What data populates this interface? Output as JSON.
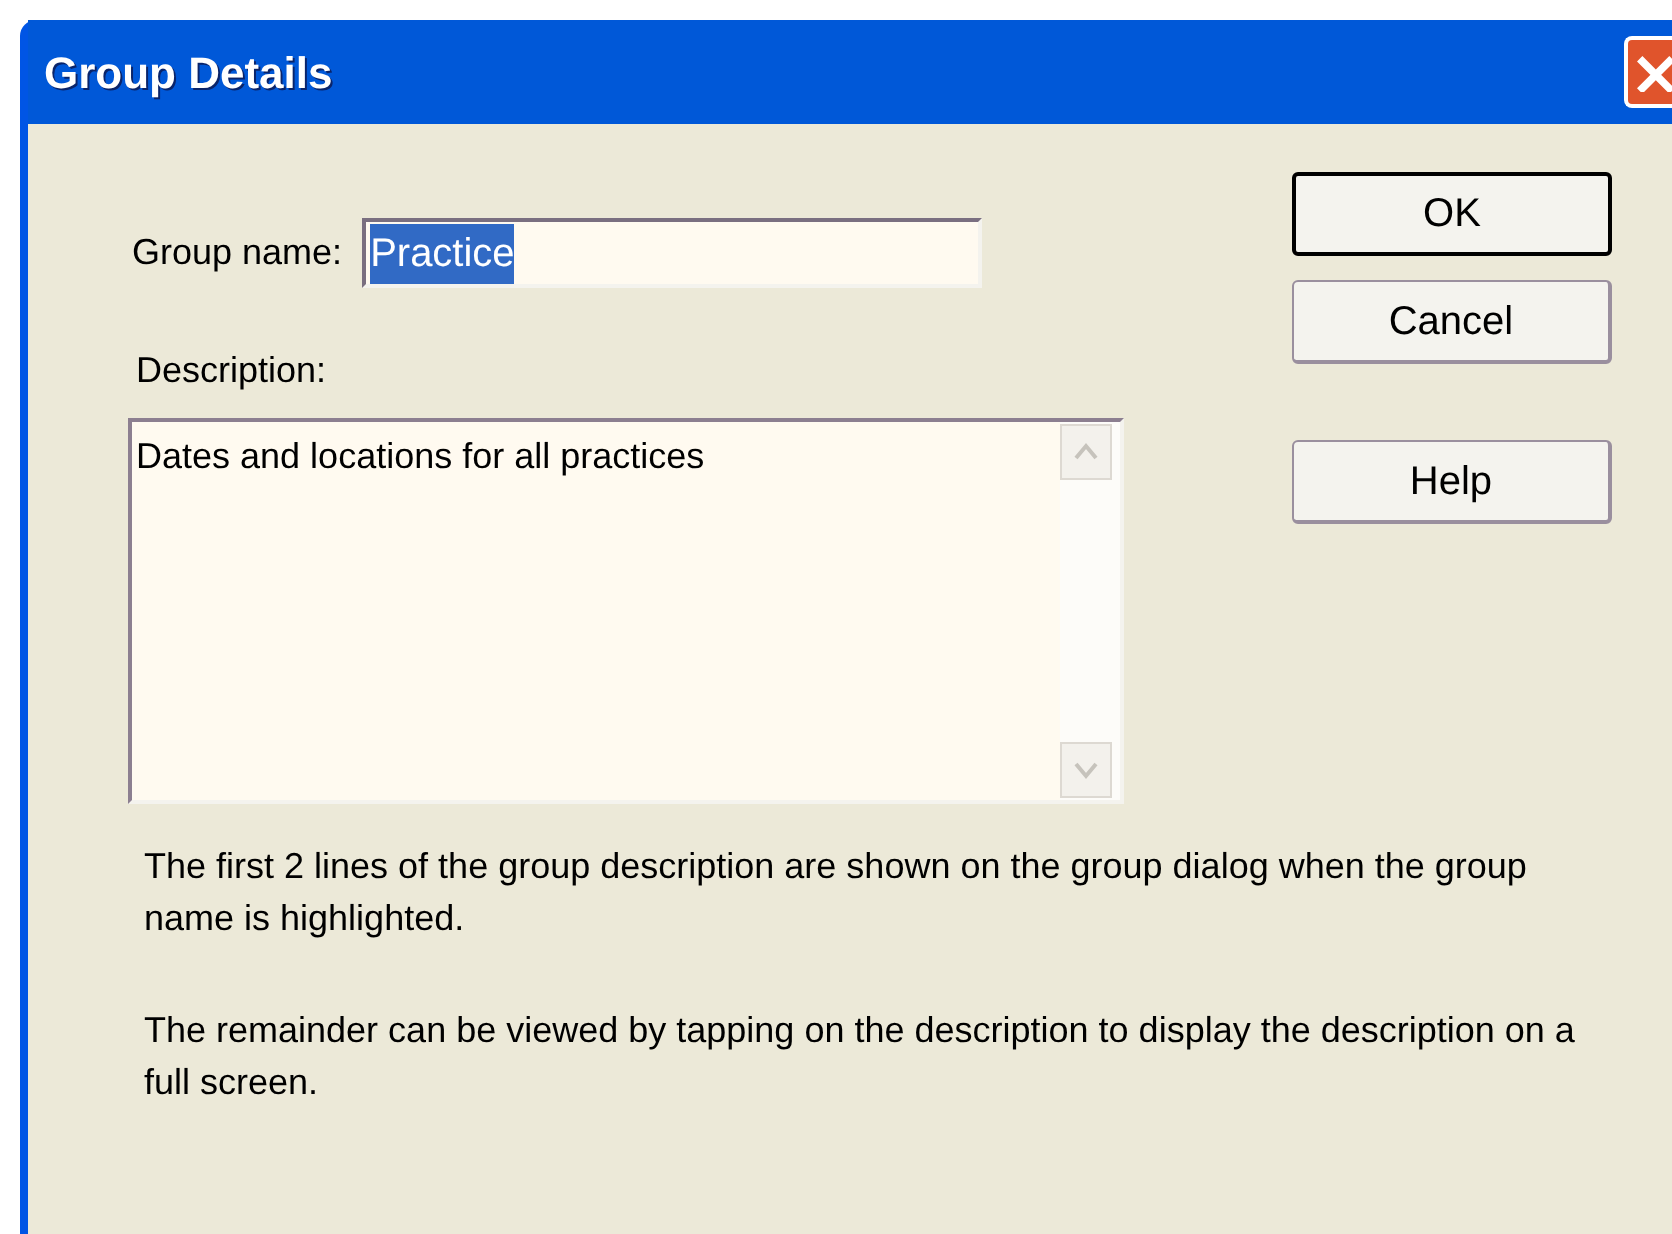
{
  "window": {
    "title": "Group Details"
  },
  "group_name": {
    "label": "Group name:",
    "value": "Practice",
    "selected": true
  },
  "description": {
    "label": "Description:",
    "value": "Dates and locations for all practices"
  },
  "buttons": [
    {
      "label": "OK",
      "default": true
    },
    {
      "label": "Cancel",
      "default": false
    },
    {
      "label": "Help",
      "default": false
    }
  ],
  "notes": [
    "The first 2 lines of the group description are shown on the group dialog when the group name is highlighted.",
    "The remainder can be viewed by tapping on the description to display the description on a full screen."
  ]
}
